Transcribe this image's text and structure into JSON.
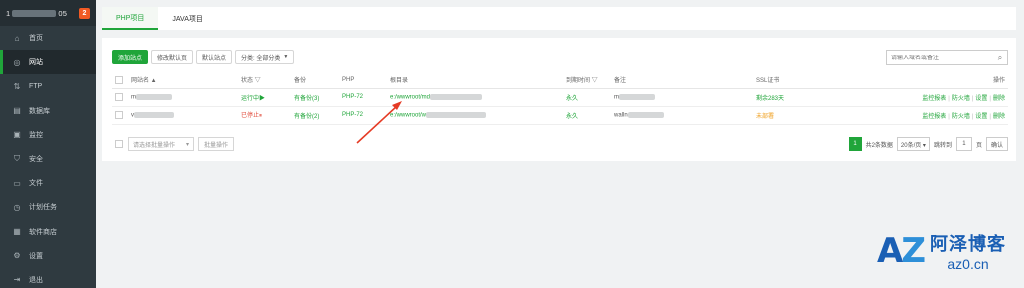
{
  "sidebar": {
    "host_prefix": "1",
    "host_suffix": "05",
    "badge": "2",
    "items": [
      {
        "icon": "home-icon",
        "glyph": "⌂",
        "label": "首页"
      },
      {
        "icon": "globe-icon",
        "glyph": "◎",
        "label": "网站"
      },
      {
        "icon": "ftp-icon",
        "glyph": "⇅",
        "label": "FTP"
      },
      {
        "icon": "database-icon",
        "glyph": "▤",
        "label": "数据库"
      },
      {
        "icon": "monitor-icon",
        "glyph": "▣",
        "label": "监控"
      },
      {
        "icon": "shield-icon",
        "glyph": "⛉",
        "label": "安全"
      },
      {
        "icon": "folder-icon",
        "glyph": "▭",
        "label": "文件"
      },
      {
        "icon": "clock-icon",
        "glyph": "◷",
        "label": "计划任务"
      },
      {
        "icon": "store-icon",
        "glyph": "▦",
        "label": "软件商店"
      },
      {
        "icon": "gear-icon",
        "glyph": "⚙",
        "label": "设置"
      },
      {
        "icon": "logout-icon",
        "glyph": "⇥",
        "label": "退出"
      }
    ]
  },
  "tabs": [
    "PHP项目",
    "JAVA项目"
  ],
  "toolbar": {
    "add": "添加站点",
    "default_page": "修改默认页",
    "default_site": "默认站点",
    "category": "分类: 全部分类"
  },
  "search": {
    "placeholder": "请输入域名或备注"
  },
  "table": {
    "headers": {
      "name": "网站名 ▲",
      "status": "状态 ▽",
      "backup": "备份",
      "php": "PHP",
      "root": "根目录",
      "expire": "到期时间 ▽",
      "remark": "备注",
      "ssl": "SSL证书",
      "ops": "操作"
    },
    "rows": [
      {
        "name": "m",
        "status": "运行中▶",
        "backup": "有备份(3)",
        "php": "PHP-72",
        "root": "e:/wwwroot/md",
        "expire": "永久",
        "remark": "m",
        "ssl": "剩余283天"
      },
      {
        "name": "v",
        "status": "已停止⏸",
        "backup": "有备份(2)",
        "php": "PHP-72",
        "root": "e:/wwwroot/w",
        "expire": "永久",
        "remark": "walln",
        "ssl": "未部署"
      }
    ],
    "ops": {
      "monitor": "监控报表",
      "firewall": "防火墙",
      "settings": "设置",
      "delete": "删除"
    }
  },
  "footer": {
    "batch_select": "请选择批量操作",
    "batch_btn": "批量操作",
    "page": "1",
    "total": "共2条数据",
    "page_size": "20条/页 ▾",
    "jump_label": "跳转到",
    "jump_value": "1",
    "page_unit": "页",
    "confirm": "确认"
  },
  "watermark": {
    "logo": "AZ",
    "name": "阿泽博客",
    "url": "az0.cn"
  },
  "colors": {
    "accent": "#20a53a",
    "sidebar": "#2f3a40",
    "danger": "#e24c3c",
    "warn": "#f0a020",
    "annotation_arrow": "#e53b25"
  }
}
